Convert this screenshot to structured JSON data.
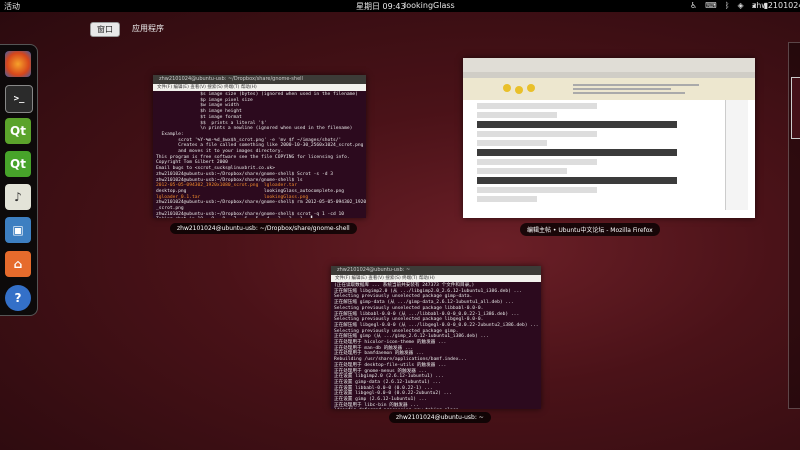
{
  "topbar": {
    "activities": "活动",
    "datetime": "星期日 09:43",
    "app_name": "lookingGlass",
    "username": "zhw2101024",
    "tray_icons": [
      "accessibility-icon",
      "keyboard-icon",
      "bluetooth-icon",
      "network-icon",
      "volume-icon",
      "battery-icon"
    ]
  },
  "viewbar": {
    "windows_label": "窗口",
    "apps_label": "应用程序"
  },
  "dash": {
    "items": [
      {
        "name": "firefox-icon",
        "glyph": "●"
      },
      {
        "name": "terminal-icon",
        "glyph": ">_"
      },
      {
        "name": "qt-designer-icon",
        "glyph": "Qt"
      },
      {
        "name": "qt-creator-icon",
        "glyph": "Qt"
      },
      {
        "name": "rhythmbox-icon",
        "glyph": "♪"
      },
      {
        "name": "photos-icon",
        "glyph": "▣"
      },
      {
        "name": "home-folder-icon",
        "glyph": "⌂"
      },
      {
        "name": "help-icon",
        "glyph": "?"
      }
    ]
  },
  "windows": {
    "terminal1": {
      "title": "zhw2101024@ubuntu-usb: ~/Dropbox/share/gnome-shell",
      "menu": "文件(F)  编辑(E)  查看(V)  搜索(S)  终端(T)  帮助(H)",
      "lines": [
        "                $s image size (bytes) (ignored when used in the filename)",
        "                $p image pixel size",
        "                $w image width",
        "                $h image height",
        "                $t image format",
        "                $$  prints a literal '$'",
        "                \\n prints a newline (ignored when used in the filename)",
        "  Example:",
        "        scrot '%Y-%m-%d_$wx$h_scrot.png' -e 'mv $f ~/images/shots/'",
        "        Creates a file called something like 2000-10-30_2560x1024_scrot.png",
        "        and moves it to your images directory.",
        "",
        "This program is free software see the file COPYING for licensing info.",
        "Copyright Tom Gilbert 2000",
        "Email bugs to <scrot_sucks@linuxbrit.co.uk>",
        "zhw2101024@ubuntu-usb:~/Dropbox/share/gnome-shell$ Scrot -s -d 3",
        "zhw2101024@ubuntu-usb:~/Dropbox/share/gnome-shell$ ls",
        "2012-05-05-094302_1920x1080_scrot.png  lgloader.tar",
        "desktop.png                            lookingGlass_autocomplete.png",
        "lgloader_0.1.tar                       lookingGlass.png",
        "zhw2101024@ubuntu-usb:~/Dropbox/share/gnome-shell$ rm 2012-05-05-094302_1920x1080",
        "_scrot.png",
        "zhw2101024@ubuntu-usb:~/Dropbox/share/gnome-shell$ scrot -q 1 -cd 10",
        "Taking shot in 10.. 9.. 8.. 7.. 6.. 5.. 4.. 3.. 2.. 1.. ▌"
      ]
    },
    "firefox": {
      "title": "编辑主帖 • Ubuntu中文论坛 - Mozilla Firefox"
    },
    "terminal2": {
      "title": "zhw2101024@ubuntu-usb: ~",
      "menu": "文件(F)  编辑(E)  查看(V)  搜索(S)  终端(T)  帮助(H)",
      "lines": [
        "(正在读取数据库 ... 系统当前共安装有 247373 个文件和目录。)",
        "正在解压缩 libgimp2.0 (从 .../libgimp2.0_2.6.12-1ubuntu1_i386.deb) ...",
        "Selecting previously unselected package gimp-data.",
        "正在解压缩 gimp-data (从 .../gimp-data_2.6.12-1ubuntu1_all.deb) ...",
        "Selecting previously unselected package libbabl-0.0-0.",
        "正在解压缩 libbabl-0.0-0 (从 .../libbabl-0.0-0_0.0.22-1_i386.deb) ...",
        "Selecting previously unselected package libgegl-0.0-0.",
        "正在解压缩 libgegl-0.0-0 (从 .../libgegl-0.0-0_0.0.22-2ubuntu2_i386.deb) ...",
        "Selecting previously unselected package gimp.",
        "正在解压缩 gimp (从 .../gimp_2.6.12-1ubuntu1_i386.deb) ...",
        "正在处理用于 hicolor-icon-theme 的触发器 ...",
        "正在处理用于 man-db 的触发器 ...",
        "正在处理用于 bamfdaemon 的触发器 ...",
        "Rebuilding /usr/share/applications/bamf.index...",
        "正在处理用于 desktop-file-utils 的触发器 ...",
        "正在处理用于 gnome-menus 的触发器 ...",
        "正在设置 libgimp2.0 (2.6.12-1ubuntu1) ...",
        "正在设置 gimp-data (2.6.12-1ubuntu1) ...",
        "正在设置 libbabl-0.0-0 (0.0.22-1) ...",
        "正在设置 libgegl-0.0-0 (0.0.22-2ubuntu2) ...",
        "正在设置 gimp (2.6.12-1ubuntu1) ...",
        "正在处理用于 libc-bin 的触发器 ...",
        "ldconfig deferred processing now taking place",
        "zhw2101024@ubuntu-usb:~$ ▌"
      ]
    }
  },
  "colors": {
    "terminal_bg": "#2c0a1e",
    "topbar_bg": "#000000",
    "accent": "#dd4814"
  }
}
